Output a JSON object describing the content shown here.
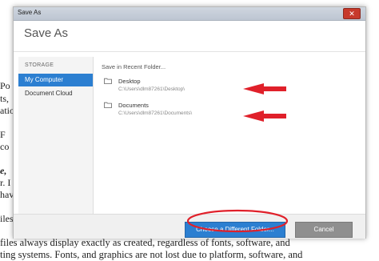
{
  "background_document": {
    "fragments": [
      "Po",
      "ts,",
      "atio",
      "F",
      "co",
      "e,",
      "r. I",
      "hav",
      "iles"
    ],
    "lines": [
      "files always display exactly as created, regardless of fonts, software, and",
      "ting systems. Fonts, and graphics are not lost due to platform, software, and"
    ]
  },
  "dialog": {
    "window_title": "Save As",
    "heading": "Save As",
    "close_label": "✕",
    "sidebar": {
      "header": "STORAGE",
      "items": [
        {
          "label": "My Computer",
          "active": true
        },
        {
          "label": "Document Cloud",
          "active": false
        }
      ]
    },
    "main": {
      "header": "Save in Recent Folder...",
      "folders": [
        {
          "name": "Desktop",
          "path": "C:\\Users\\dlm87261\\Desktop\\"
        },
        {
          "name": "Documents",
          "path": "C:\\Users\\dlm87261\\Documents\\"
        }
      ]
    },
    "buttons": {
      "choose_folder": "Choose a Different Folder...",
      "cancel": "Cancel"
    }
  },
  "annotations": {
    "arrow_color": "#e0202a",
    "circle_color": "#e0202a",
    "accent_color": "#2c7fd1"
  }
}
